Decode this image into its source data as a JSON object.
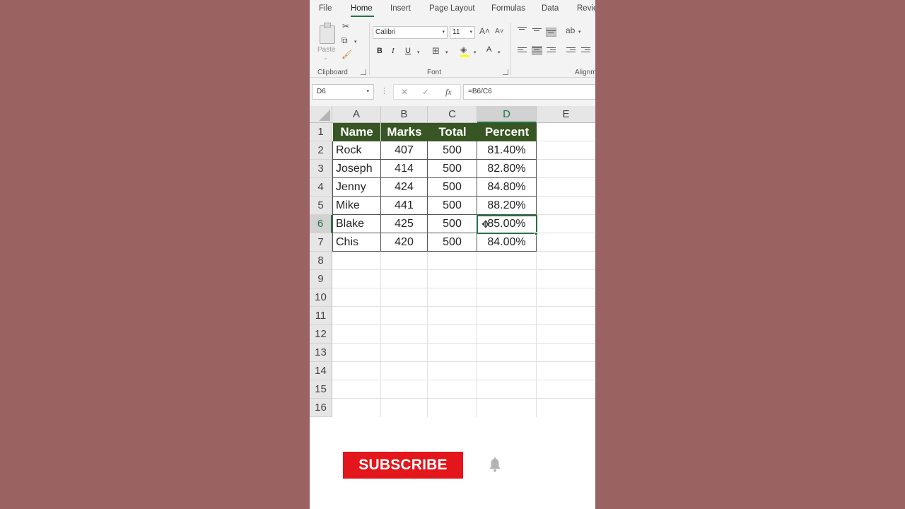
{
  "ribbon": {
    "tabs": [
      "File",
      "Home",
      "Insert",
      "Page Layout",
      "Formulas",
      "Data",
      "Revie"
    ],
    "active_tab": "Home",
    "clipboard": {
      "paste_label": "Paste",
      "group_label": "Clipboard"
    },
    "font": {
      "font_name": "Calibri",
      "font_size": "11",
      "bold": "B",
      "italic": "I",
      "underline": "U",
      "font_color_letter": "A",
      "group_label": "Font"
    },
    "alignment": {
      "group_label": "Alignm"
    }
  },
  "formula_bar": {
    "name_box": "D6",
    "cancel": "✕",
    "enter": "✓",
    "fx": "fx",
    "formula": "=B6/C6"
  },
  "sheet": {
    "columns": [
      "A",
      "B",
      "C",
      "D",
      "E"
    ],
    "selected_column": "D",
    "rows": [
      "1",
      "2",
      "3",
      "4",
      "5",
      "6",
      "7",
      "8",
      "9",
      "10",
      "11",
      "12",
      "13",
      "14",
      "15",
      "16"
    ],
    "selected_row": "6",
    "header": [
      "Name",
      "Marks",
      "Total",
      "Percent"
    ],
    "data": [
      [
        "Rock",
        "407",
        "500",
        "81.40%"
      ],
      [
        "Joseph",
        "414",
        "500",
        "82.80%"
      ],
      [
        "Jenny",
        "424",
        "500",
        "84.80%"
      ],
      [
        "Mike",
        "441",
        "500",
        "88.20%"
      ],
      [
        "Blake",
        "425",
        "500",
        "85.00%"
      ],
      [
        "Chis",
        "420",
        "500",
        "84.00%"
      ]
    ],
    "active_cell": "D6"
  },
  "subscribe": {
    "label": "SUBSCRIBE"
  },
  "colors": {
    "header_fill": "#375623",
    "excel_green": "#217346",
    "subscribe_red": "#e3161b",
    "background": "#9a6362"
  }
}
